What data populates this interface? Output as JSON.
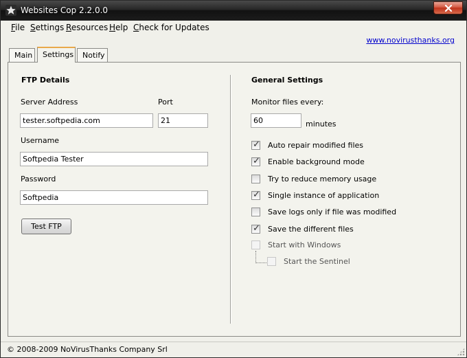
{
  "window": {
    "title": "Websites Cop 2.2.0.0",
    "accent_color": "#e8a84a",
    "close_color": "#c0331c"
  },
  "menu": {
    "items": [
      {
        "label": "File"
      },
      {
        "label": "Settings"
      },
      {
        "label": "Resources"
      },
      {
        "label": "Help"
      },
      {
        "label": "Check for Updates"
      }
    ],
    "link": "www.novirusthanks.org"
  },
  "tabs": [
    {
      "label": "Main",
      "active": false
    },
    {
      "label": "Settings",
      "active": true
    },
    {
      "label": "Notify",
      "active": false
    }
  ],
  "ftp": {
    "title": "FTP Details",
    "server_label": "Server Address",
    "server_value": "tester.softpedia.com",
    "port_label": "Port",
    "port_value": "21",
    "username_label": "Username",
    "username_value": "Softpedia Tester",
    "password_label": "Password",
    "password_value": "Softpedia",
    "test_button": "Test FTP"
  },
  "general": {
    "title": "General Settings",
    "monitor_label": "Monitor files every:",
    "monitor_value": "60",
    "minutes_label": "minutes",
    "options": [
      {
        "label": "Auto repair modified files",
        "checked": true,
        "enabled": true
      },
      {
        "label": "Enable background mode",
        "checked": true,
        "enabled": true
      },
      {
        "label": "Try to reduce memory usage",
        "checked": false,
        "enabled": true
      },
      {
        "label": "Single instance of application",
        "checked": true,
        "enabled": true
      },
      {
        "label": "Save logs only if file was modified",
        "checked": false,
        "enabled": true
      },
      {
        "label": "Save the different files",
        "checked": true,
        "enabled": true
      },
      {
        "label": "Start with Windows",
        "checked": false,
        "enabled": false
      },
      {
        "label": "Start the Sentinel",
        "checked": false,
        "enabled": false
      }
    ]
  },
  "status": {
    "text": "© 2008-2009 NoVirusThanks Company Srl"
  }
}
